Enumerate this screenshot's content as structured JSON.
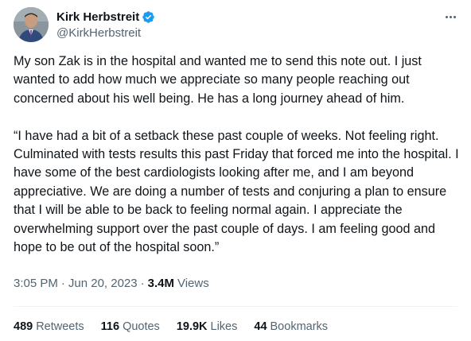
{
  "author": {
    "name": "Kirk Herbstreit",
    "handle": "@KirkHerbstreit",
    "verified": true
  },
  "tweet": {
    "paragraph1": "My son Zak is in the hospital and wanted me to send this note out. I just wanted to add how much we appreciate so many people reaching out concerned about his well being. He has a long journey ahead of him.",
    "paragraph2": "“I have had a bit of a setback these past couple of weeks. Not feeling right. Culminated with tests results this past Friday that forced me into the hospital. I have some of the best cardiologists looking after me, and I am beyond appreciative. We are doing a number of tests and conjuring a plan to ensure that I will be able to be back to feeling normal again. I appreciate the overwhelming support over the past couple of days. I am feeling good and hope to be out of the hospital soon.”"
  },
  "meta": {
    "time": "3:05 PM",
    "date": "Jun 20, 2023",
    "separator": "·",
    "views_count": "3.4M",
    "views_label": "Views"
  },
  "stats": {
    "retweets_count": "489",
    "retweets_label": "Retweets",
    "quotes_count": "116",
    "quotes_label": "Quotes",
    "likes_count": "19.9K",
    "likes_label": "Likes",
    "bookmarks_count": "44",
    "bookmarks_label": "Bookmarks"
  },
  "icons": {
    "verified": "verified-badge-icon",
    "more": "more-options-icon"
  },
  "colors": {
    "verified_blue": "#1d9bf0",
    "text_primary": "#0f1419",
    "text_secondary": "#536471",
    "divider": "#eff3f4"
  }
}
